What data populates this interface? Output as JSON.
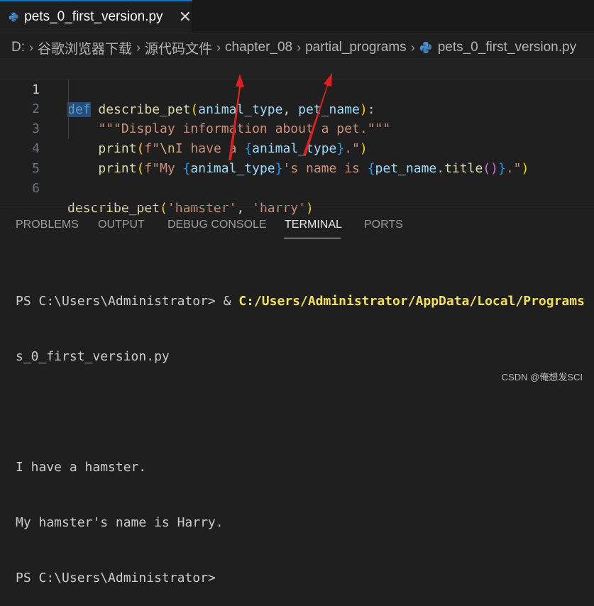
{
  "tab": {
    "title": "pets_0_first_version.py",
    "close_glyph": "✕"
  },
  "breadcrumb": {
    "segments": [
      "D:",
      "谷歌浏览器下载",
      "源代码文件",
      "chapter_08",
      "partial_programs",
      "pets_0_first_version.py"
    ]
  },
  "editor": {
    "line_numbers": [
      "1",
      "2",
      "3",
      "4",
      "5",
      "6"
    ],
    "line1": {
      "def": "def",
      "fname": "describe_pet",
      "p1": "animal_type",
      "comma": ", ",
      "p2": "pet_name",
      "colon": ":"
    },
    "line2": {
      "docstring": "\"\"\"Display information about a pet.\"\"\""
    },
    "line3": {
      "print": "print",
      "prefix": "f\"",
      "esc": "\\n",
      "text": "I have a ",
      "var": "animal_type",
      "suffix": ".\""
    },
    "line4": {
      "print": "print",
      "prefix": "f\"My ",
      "var1": "animal_type",
      "mid": "'s name is ",
      "var2": "pet_name",
      "method": "title",
      "suffix": ".\""
    },
    "line6": {
      "fname": "describe_pet",
      "arg1": "'hamster'",
      "comma": ", ",
      "arg2": "'harry'"
    }
  },
  "panel": {
    "tabs": [
      "PROBLEMS",
      "OUTPUT",
      "DEBUG CONSOLE",
      "TERMINAL",
      "PORTS"
    ],
    "active_tab": "TERMINAL"
  },
  "terminal": {
    "prompt1": "PS C:\\Users\\Administrator> & ",
    "command_path": "C:/Users/Administrator/AppData/Local/Programs",
    "wrap": "s_0_first_version.py",
    "output1": "I have a hamster.",
    "output2": "My hamster's name is Harry.",
    "prompt2": "PS C:\\Users\\Administrator>"
  },
  "watermark": "CSDN @俺想发SCI",
  "colors": {
    "accent": "#0078d4",
    "keyword": "#569cd6",
    "function": "#dcdcaa",
    "param": "#9cdcfe",
    "string": "#ce9178",
    "arrow": "#e02020"
  }
}
